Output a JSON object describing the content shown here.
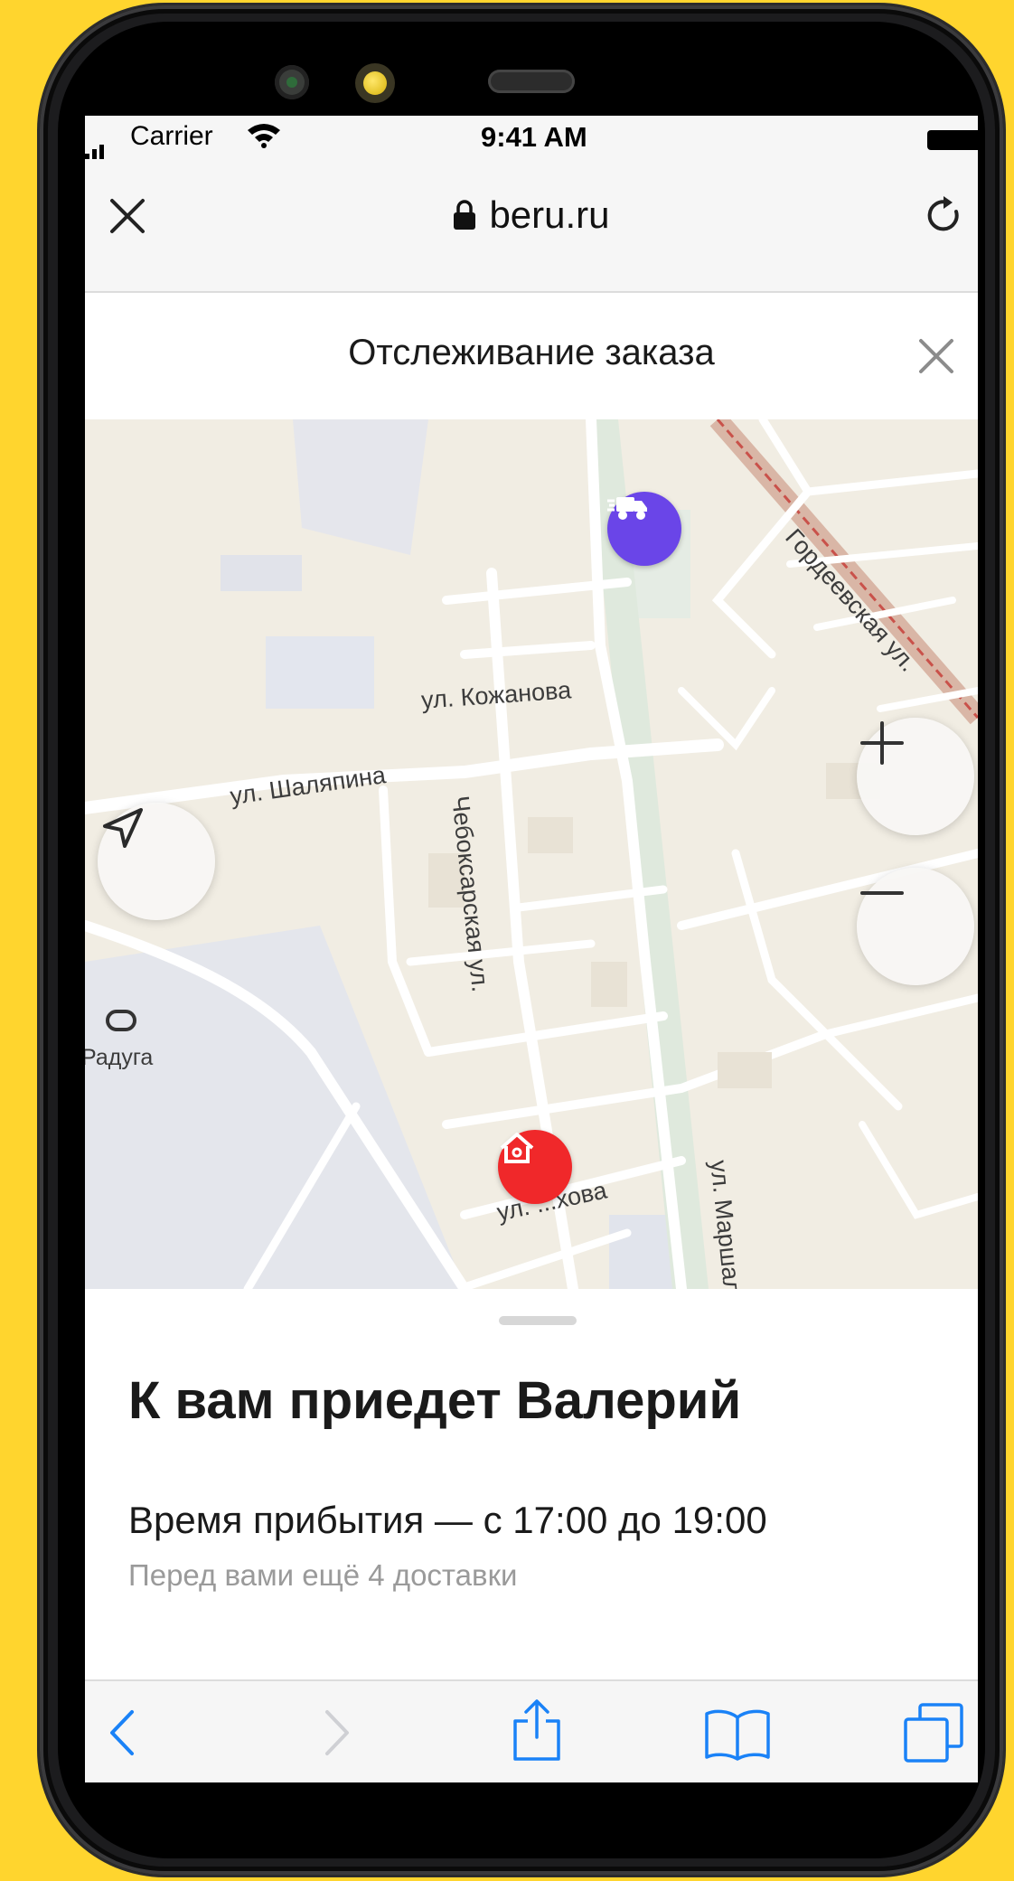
{
  "status_bar": {
    "carrier": "Carrier",
    "time": "9:41 AM"
  },
  "browser": {
    "domain": "beru.ru"
  },
  "page": {
    "title": "Отслеживание заказа"
  },
  "map": {
    "streets": {
      "gordeevskaya": "Гордеевская ул.",
      "kozhanova": "ул. Кожанова",
      "shalyapina": "ул. Шаляпина",
      "cheboksarskaya": "Чебоксарская ул.",
      "raduga": "Радуга",
      "ul_khova": "ул. ...хова",
      "marshala": "ул. Маршал..."
    },
    "zoom_in_label": "+",
    "zoom_out_label": "−"
  },
  "sheet": {
    "heading": "К вам приедет Валерий",
    "eta": "Время прибытия — с 17:00 до 19:00",
    "queue": "Перед вами ещё 4 доставки"
  },
  "colors": {
    "background": "#FFD52E",
    "courier_pin": "#6A45E8",
    "home_pin": "#F0282A",
    "ios_blue": "#1A82F7"
  },
  "icons": {
    "courier": "truck-icon",
    "home": "home-icon",
    "locate": "navigation-arrow-icon",
    "back": "chevron-left-icon",
    "forward": "chevron-right-icon",
    "share": "share-icon",
    "bookmarks": "book-icon",
    "tabs": "tabs-icon"
  }
}
